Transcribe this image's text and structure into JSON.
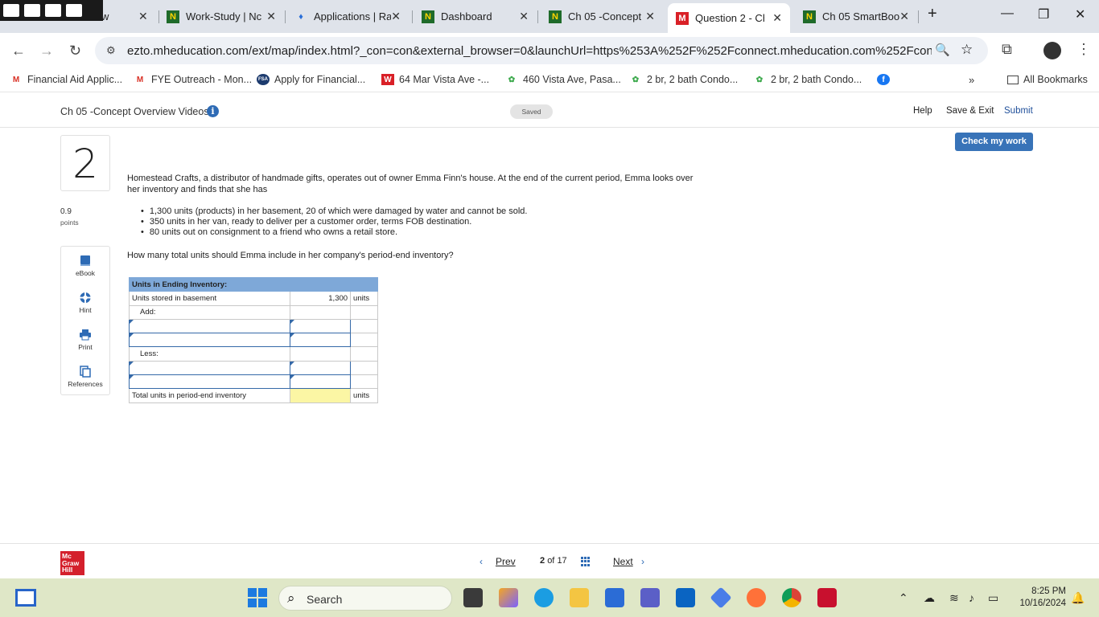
{
  "browser": {
    "tabs": [
      {
        "title": "w",
        "icon": "capture-tools"
      },
      {
        "title": "Work-Study | Nc",
        "icon": "n-icon"
      },
      {
        "title": "Applications | Ra",
        "icon": "flame-icon"
      },
      {
        "title": "Dashboard",
        "icon": "n-icon"
      },
      {
        "title": "Ch 05 -Concept",
        "icon": "n-icon"
      },
      {
        "title": "Question 2 - Ch",
        "icon": "m-icon",
        "active": true
      },
      {
        "title": "Ch 05 SmartBoo",
        "icon": "n-icon"
      }
    ],
    "url": "ezto.mheducation.com/ext/map/index.html?_con=con&external_browser=0&launchUrl=https%253A%252F%252Fconnect.mheducation.com%252Fconnect%25...",
    "bookmarks": [
      {
        "label": "Financial Aid Applic...",
        "icon": "gmail-icon"
      },
      {
        "label": "FYE Outreach - Mon...",
        "icon": "gmail-icon"
      },
      {
        "label": "Apply for Financial...",
        "icon": "fsa-icon"
      },
      {
        "label": "64 Mar Vista Ave -...",
        "icon": "w-icon"
      },
      {
        "label": "460 Vista Ave, Pasa...",
        "icon": "spinner-icon"
      },
      {
        "label": "2 br, 2 bath Condo...",
        "icon": "spinner-icon"
      },
      {
        "label": "2 br, 2 bath Condo...",
        "icon": "spinner-icon"
      }
    ],
    "all_bookmarks": "All Bookmarks"
  },
  "app": {
    "title": "Ch 05 -Concept Overview Videos",
    "saved": "Saved",
    "help": "Help",
    "save_exit": "Save & Exit",
    "submit": "Submit",
    "check_my_work": "Check my work"
  },
  "question": {
    "number": "2",
    "points_value": "0.9",
    "points_label": "points",
    "tools": [
      "eBook",
      "Hint",
      "Print",
      "References"
    ],
    "intro": "Homestead Crafts, a distributor of handmade gifts, operates out of owner Emma Finn's house. At the end of the current period, Emma looks over her inventory and finds that she has",
    "bullets": [
      "1,300 units (products) in her basement, 20 of which were damaged by water and cannot be sold.",
      "350 units in her van, ready to deliver per a customer order, terms FOB destination.",
      "80 units out on consignment to a friend who owns a retail store."
    ],
    "ask": "How many total units should Emma include in her company's period-end inventory?"
  },
  "inventory_table": {
    "header": "Units in Ending Inventory:",
    "basement_label": "Units stored in basement",
    "basement_value": "1,300",
    "unit": "units",
    "add_label": "Add:",
    "less_label": "Less:",
    "total_label": "Total units in period-end inventory",
    "total_unit": "units"
  },
  "footer": {
    "logo": "Mc Graw Hill",
    "prev": "Prev",
    "page_current": "2",
    "page_of": "of",
    "page_total": "17",
    "next": "Next"
  },
  "taskbar": {
    "search": "Search",
    "time": "8:25 PM",
    "date": "10/16/2024"
  }
}
